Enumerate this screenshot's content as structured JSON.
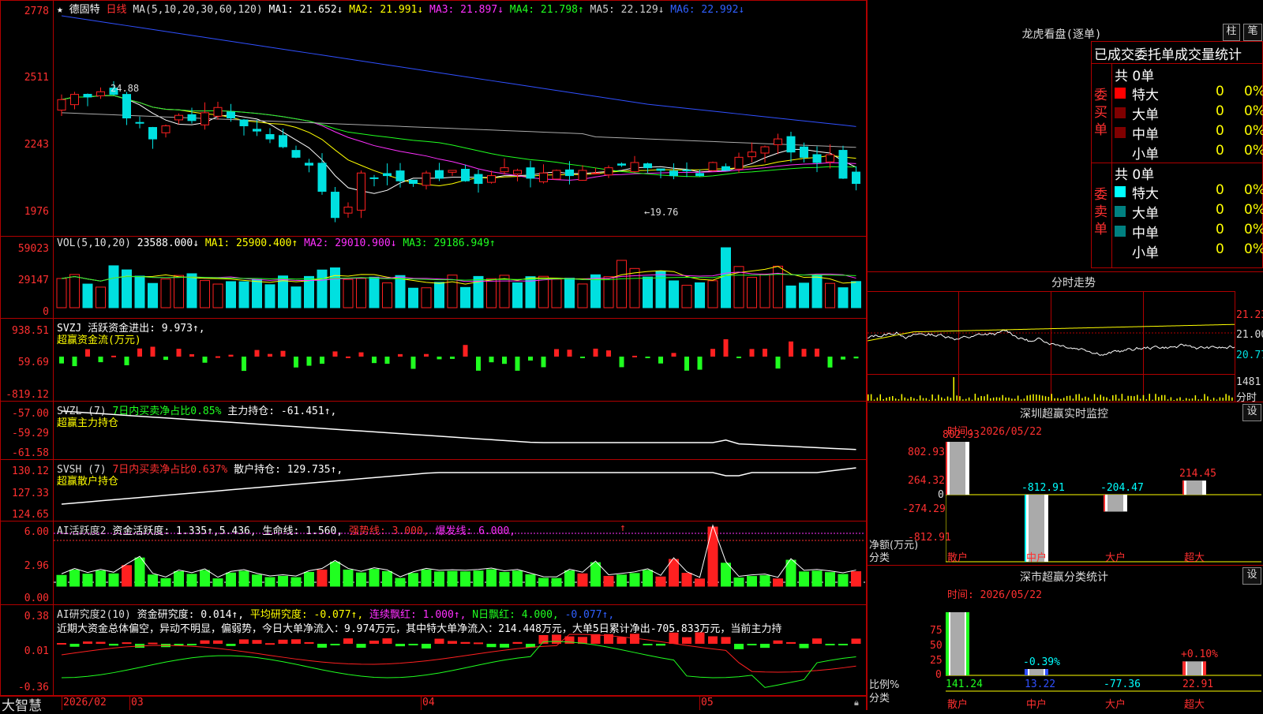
{
  "main_chart": {
    "title_prefix": "★",
    "stock_name": "德固特",
    "period": "日线",
    "ma_params": "MA(5,10,20,30,60,120)",
    "ma1": "MA1: 21.652↓",
    "ma2": "MA2: 21.991↓",
    "ma3": "MA3: 21.897↓",
    "ma4": "MA4: 21.798↑",
    "ma5": "MA5: 22.129↓",
    "ma6": "MA6: 22.992↓",
    "yticks": [
      "2778",
      "2511",
      "2243",
      "1976"
    ],
    "high_mark": "24.88",
    "low_mark": "←19.76"
  },
  "vol": {
    "legend_name": "VOL(5,10,20)",
    "value": "23588.000↓",
    "ma1": "MA1: 25900.400↑",
    "ma2": "MA2: 29010.900↓",
    "ma3": "MA3: 29186.949↑",
    "yticks": [
      "59023",
      "29147",
      "0"
    ]
  },
  "svzj": {
    "legend": "SVZJ  活跃资金进出: 9.973↑,",
    "legend2": "超赢资金流(万元)",
    "yticks": [
      "938.51",
      "59.69",
      "-819.12"
    ]
  },
  "svzl": {
    "prefix": "SVZL (7)",
    "part1": "7日内买卖净占比0.85%",
    "part2": "主力持仓: -61.451↑,",
    "legend2": "超赢主力持仓",
    "yticks": [
      "-57.00",
      "-59.29",
      "-61.58"
    ]
  },
  "svsh": {
    "prefix": "SVSH (7)",
    "part1": "7日内买卖净占比0.637%",
    "part2": "散户持仓: 129.735↑,",
    "legend2": "超赢散户持仓",
    "yticks": [
      "130.12",
      "127.33",
      "124.65"
    ]
  },
  "ai_active": {
    "prefix": "AI活跃度2",
    "part1": "资金活跃度: 1.335↑,5.436,",
    "part2": "生命线: 1.560,",
    "part3": "强势线: 3.000,",
    "part4": "爆发线: 6.000,",
    "arrow": "↑",
    "yticks": [
      "6.00",
      "2.96",
      "0.00"
    ]
  },
  "ai_research": {
    "prefix": "AI研究度2(10)",
    "part1": "资金研究度: 0.014↑,",
    "part2": "平均研究度: -0.077↑,",
    "part3": "连续飘红: 1.000↑,",
    "part4": "N日飘红: 4.000,",
    "part5": "-0.077↑,",
    "summary": "近期大资金总体偏空，异动不明显，偏弱势，今日大单净流入：9.974万元，其中特大单净流入：214.448万元，大单5日累计净出-705.833万元，当前主力持",
    "yticks": [
      "0.38",
      "0.01",
      "-0.36"
    ]
  },
  "x_axis": {
    "brand": "大智慧",
    "labels": [
      "2026/02",
      "03",
      "04",
      "05"
    ]
  },
  "dragon_panel": {
    "title": "龙虎看盘(逐单)",
    "btn_zhu": "柱",
    "btn_bi": "笔",
    "subtitle": "已成交委托单成交量统计",
    "buy_label": "委买单",
    "sell_label": "委卖单",
    "buy_total": "共 0单",
    "sell_total": "共 0单",
    "buy_rows": [
      {
        "name": "特大",
        "count": "0",
        "pct": "0%"
      },
      {
        "name": "大单",
        "count": "0",
        "pct": "0%"
      },
      {
        "name": "中单",
        "count": "0",
        "pct": "0%"
      },
      {
        "name": "小单",
        "count": "0",
        "pct": "0%"
      }
    ],
    "sell_rows": [
      {
        "name": "特大",
        "count": "0",
        "pct": "0%"
      },
      {
        "name": "大单",
        "count": "0",
        "pct": "0%"
      },
      {
        "name": "中单",
        "count": "0",
        "pct": "0%"
      },
      {
        "name": "小单",
        "count": "0",
        "pct": "0%"
      }
    ]
  },
  "intraday": {
    "title": "分时走势",
    "yticks": [
      "21.23",
      "21.00",
      "20.77"
    ],
    "vol_label": "1481",
    "vol_unit": "分时"
  },
  "sz_monitor": {
    "title": "深圳超赢实时监控",
    "btn": "设",
    "time": "时间: 2026/05/22",
    "yticks": [
      "802.93",
      "264.32",
      "0",
      "-274.29",
      "-812.91"
    ],
    "ylabel1": "净额(万元)",
    "ylabel2": "分类",
    "categories": [
      "散户",
      "中户",
      "大户",
      "超大"
    ],
    "values": [
      802.93,
      -812.91,
      -204.47,
      214.45
    ],
    "value_labels": [
      "802.93",
      "-812.91",
      "-204.47",
      "214.45"
    ]
  },
  "sz_classify": {
    "title": "深市超赢分类统计",
    "btn": "设",
    "time": "时间: 2026/05/22",
    "yticks": [
      "75",
      "50",
      "25",
      "0"
    ],
    "ylabel1": "比例%",
    "ylabel2": "分类",
    "categories": [
      "散户",
      "中户",
      "大户",
      "超大"
    ],
    "pct_labels": [
      "",
      "-0.39%",
      "",
      "+0.10%"
    ],
    "values": [
      "141.24",
      "13.22",
      "-77.36",
      "22.91"
    ],
    "heights": [
      100,
      10,
      0,
      22
    ]
  },
  "colors": {
    "up": "#ff2020",
    "down": "#00e0e0",
    "flow_up": "#ff2020",
    "flow_down": "#20ff20",
    "frame": "#b00000"
  }
}
